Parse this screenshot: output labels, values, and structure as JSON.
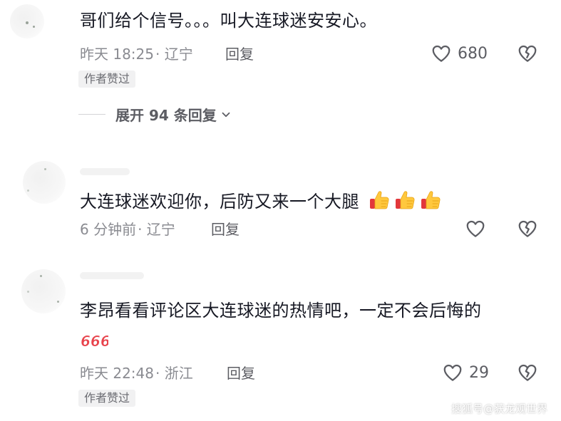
{
  "comments": [
    {
      "text": "哥们给个信号。。。叫大连球迷安安心。",
      "time": "昨天 18:25",
      "location": "· 辽宁",
      "reply_label": "回复",
      "likes": "680",
      "author_badge": "作者赞过",
      "expand_label": "展开 94 条回复"
    },
    {
      "text": "大连球迷欢迎你，后防又来一个大腿",
      "emoji": "thumbs-up-icon",
      "emoji_count": 3,
      "time": "6 分钟前",
      "location": "· 辽宁",
      "reply_label": "回复"
    },
    {
      "text": "李昂看看评论区大连球迷的热情吧，一定不会后悔的",
      "sticker": "666",
      "time": "昨天 22:48",
      "location": "· 浙江",
      "reply_label": "回复",
      "likes": "29",
      "author_badge": "作者赞过"
    }
  ],
  "watermark": "搜狐号@获龙观世界",
  "colors": {
    "text": "#161823",
    "meta": "#8a8b91",
    "action": "#5c5d63",
    "sticker": "#e8434c"
  },
  "icons": [
    "heart-outline-icon",
    "broken-heart-icon",
    "chevron-down-icon",
    "thumbs-up-icon"
  ]
}
